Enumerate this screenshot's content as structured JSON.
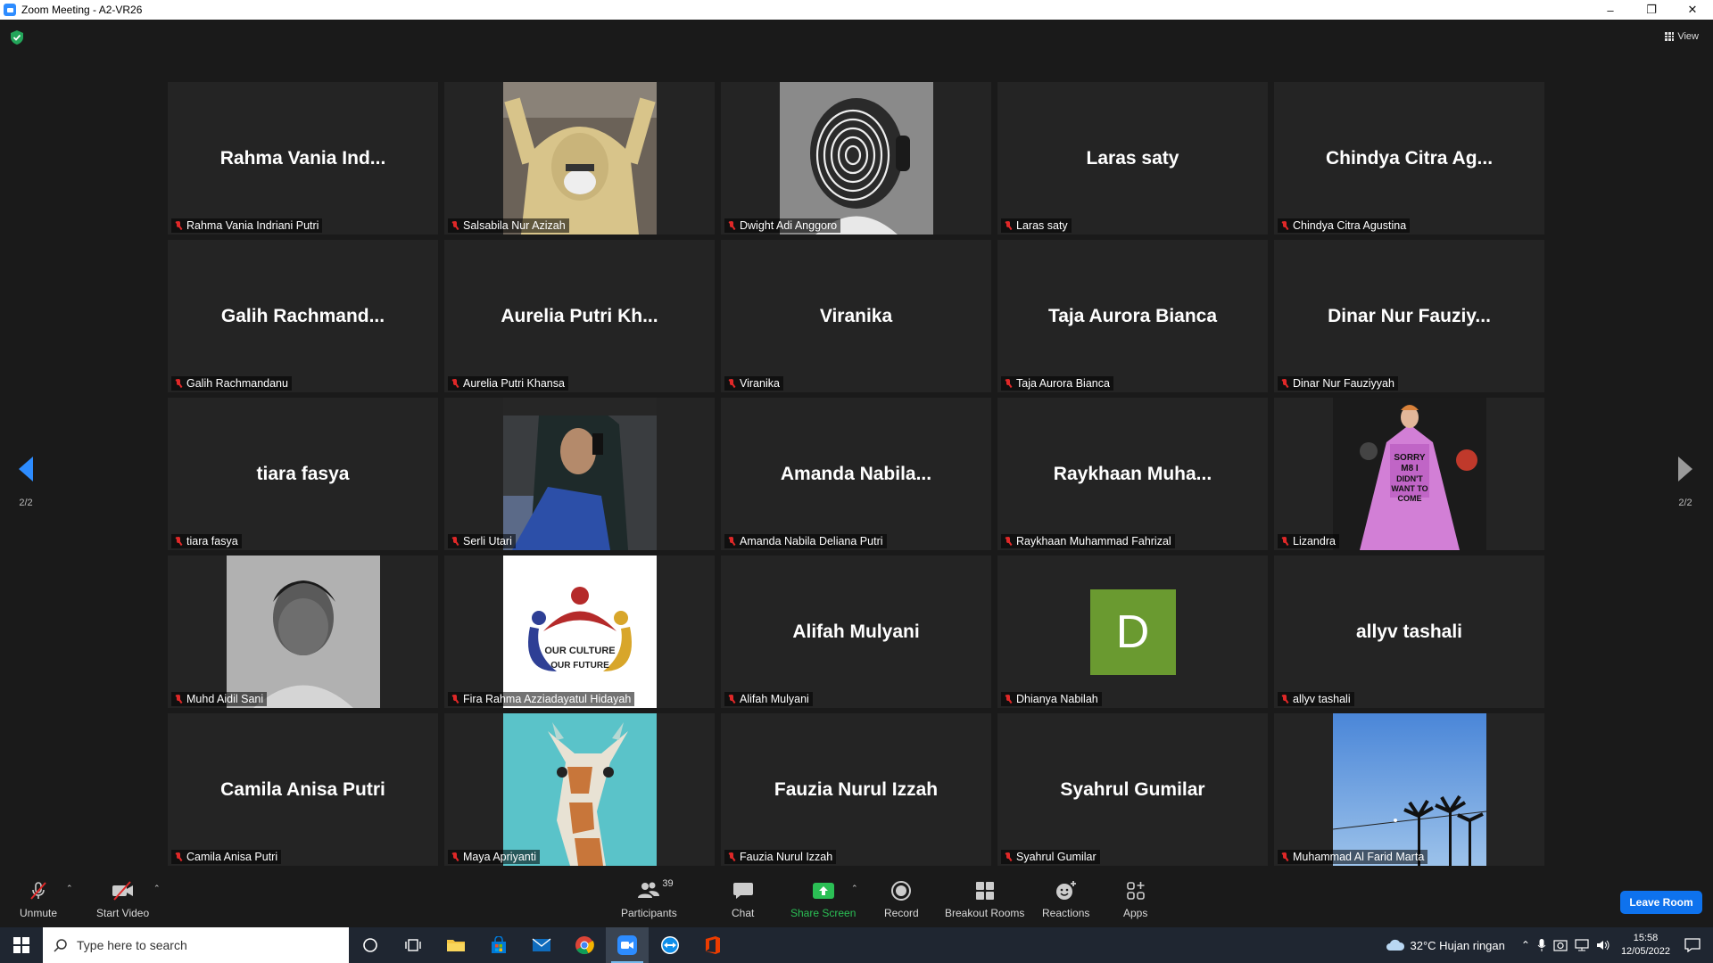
{
  "window": {
    "title": "Zoom Meeting - A2-VR26",
    "controls": [
      "–",
      "❐",
      "✕"
    ]
  },
  "header": {
    "view_label": "View"
  },
  "pagination": {
    "left": "2/2",
    "right": "2/2"
  },
  "participants": [
    {
      "display": "Rahma  Vania  Ind...",
      "name": "Rahma Vania Indriani Putri",
      "video": null
    },
    {
      "display": "",
      "name": "Salsabila Nur Azizah",
      "video": "hoodie"
    },
    {
      "display": "",
      "name": "Dwight Adi Anggoro",
      "video": "spiral"
    },
    {
      "display": "Laras saty",
      "name": "Laras saty",
      "video": null
    },
    {
      "display": "Chindya  Citra  Ag...",
      "name": "Chindya Citra Agustina",
      "video": null
    },
    {
      "display": "Galih  Rachmand...",
      "name": "Galih Rachmandanu",
      "video": null
    },
    {
      "display": "Aurelia  Putri  Kh...",
      "name": "Aurelia Putri Khansa",
      "video": null
    },
    {
      "display": "Viranika",
      "name": "Viranika",
      "video": null
    },
    {
      "display": "Taja Aurora Bianca",
      "name": "Taja Aurora Bianca",
      "video": null
    },
    {
      "display": "Dinar  Nur  Fauziy...",
      "name": "Dinar Nur Fauziyyah",
      "video": null
    },
    {
      "display": "tiara fasya",
      "name": "tiara fasya",
      "video": null
    },
    {
      "display": "",
      "name": "Serli Utari",
      "video": "selfie"
    },
    {
      "display": "Amanda  Nabila...",
      "name": "Amanda Nabila Deliana Putri",
      "video": null
    },
    {
      "display": "Raykhaan  Muha...",
      "name": "Raykhaan Muhammad Fahrizal",
      "video": null
    },
    {
      "display": "",
      "name": "Lizandra",
      "video": "dress"
    },
    {
      "display": "",
      "name": "Muhd Aidil Sani",
      "video": "bw"
    },
    {
      "display": "",
      "name": "Fira Rahma Azziadayatul Hidayah",
      "video": "logo"
    },
    {
      "display": "Alifah Mulyani",
      "name": "Alifah Mulyani",
      "video": null
    },
    {
      "display": "",
      "name": "Dhianya Nabilah",
      "video": "avatar"
    },
    {
      "display": "allyv tashali",
      "name": "allyv tashali",
      "video": null
    },
    {
      "display": "Camila Anisa Putri",
      "name": "Camila Anisa Putri",
      "video": null
    },
    {
      "display": "",
      "name": "Maya Apriyanti",
      "video": "giraffe"
    },
    {
      "display": "Fauzia Nurul Izzah",
      "name": "Fauzia Nurul Izzah",
      "video": null
    },
    {
      "display": "Syahrul Gumilar",
      "name": "Syahrul Gumilar",
      "video": null
    },
    {
      "display": "",
      "name": "Muhammad Al Farid Marta",
      "video": "sky"
    }
  ],
  "video_text": {
    "avatar_letter": "D",
    "logo_line1": "OUR CULTURE",
    "logo_line2": "OUR FUTURE",
    "dress_text": "SORRY M8 I DIDN'T WANT TO COME"
  },
  "toolbar": {
    "unmute": "Unmute",
    "start_video": "Start Video",
    "participants": "Participants",
    "participants_count": "39",
    "chat": "Chat",
    "share_screen": "Share Screen",
    "record": "Record",
    "breakout_rooms": "Breakout Rooms",
    "reactions": "Reactions",
    "apps": "Apps",
    "leave_room": "Leave Room"
  },
  "taskbar": {
    "search_placeholder": "Type here to search",
    "weather": "32°C  Hujan ringan",
    "time": "15:58",
    "date": "12/05/2022"
  },
  "colors": {
    "accent_blue": "#0e72ed",
    "muted_red": "#e02828",
    "share_green": "#2bbf55",
    "avatar_green": "#6a9a30"
  }
}
